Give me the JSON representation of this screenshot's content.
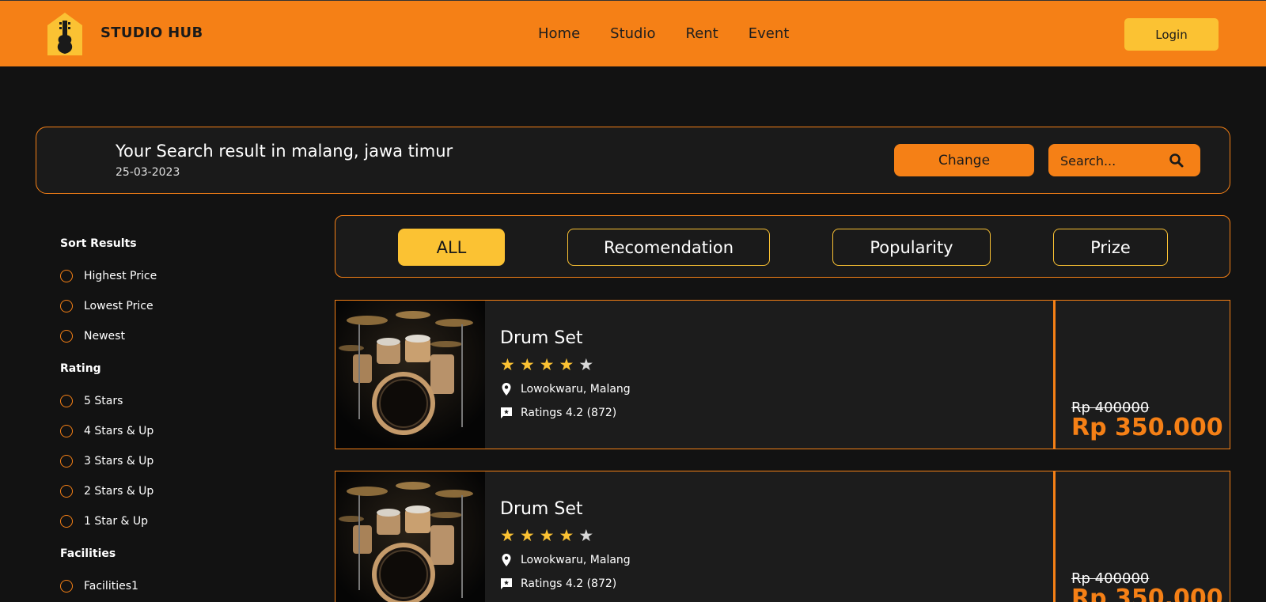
{
  "navbar": {
    "brand": "STUDIO HUB",
    "links": [
      "Home",
      "Studio",
      "Rent",
      "Event"
    ],
    "login_label": "Login"
  },
  "search": {
    "title": "Your Search result in malang, jawa timur",
    "date": "25-03-2023",
    "change_label": "Change",
    "placeholder": "Search..."
  },
  "sidebar": {
    "sort_heading": "Sort Results",
    "sort_options": [
      "Highest Price",
      "Lowest Price",
      "Newest"
    ],
    "rating_heading": "Rating",
    "rating_options": [
      "5 Stars",
      "4 Stars & Up",
      "3 Stars & Up",
      "2 Stars & Up",
      "1 Star & Up"
    ],
    "facilities_heading": "Facilities",
    "facilities_options": [
      "Facilities1"
    ]
  },
  "filters": {
    "tabs": [
      "ALL",
      "Recomendation",
      "Popularity",
      "Prize"
    ],
    "active": "ALL"
  },
  "results": [
    {
      "title": "Drum Set",
      "stars_filled": 4,
      "stars_total": 5,
      "location": "Lowokwaru, Malang",
      "ratings": "Ratings 4.2 (872)",
      "price_old": "Rp 400000",
      "price_new": "Rp 350.000"
    },
    {
      "title": "Drum Set",
      "stars_filled": 4,
      "stars_total": 5,
      "location": "Lowokwaru, Malang",
      "ratings": "Ratings 4.2 (872)",
      "price_old": "Rp 400000",
      "price_new": "Rp 350.000"
    }
  ],
  "colors": {
    "accent": "#f58016",
    "highlight": "#fbc233",
    "background": "#121212",
    "star_filled": "#fbc233",
    "star_empty": "#d8d8d8"
  }
}
